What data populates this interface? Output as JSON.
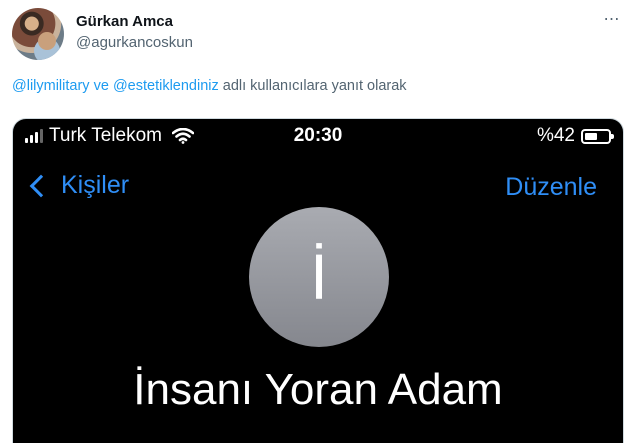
{
  "tweet": {
    "author_name": "Gürkan Amca",
    "author_handle": "@agurkancoskun",
    "more_label": "⋯",
    "reply": {
      "mention_1": "@lilymilitary",
      "joiner": " ve ",
      "mention_2": "@estetiklendiniz",
      "suffix": " adlı kullanıcılara yanıt olarak"
    },
    "accent_color": "#1d9bf0"
  },
  "phone": {
    "status_bar": {
      "carrier": "Turk Telekom",
      "time": "20:30",
      "battery": "%42",
      "signal_bars_on": 3,
      "signal_bars_total": 4,
      "battery_level": 0.42
    },
    "nav": {
      "back_label": "Kişiler",
      "edit_label": "Düzenle",
      "tint_color": "#2f8ef6"
    },
    "contact": {
      "initial": "İ",
      "name": "İnsanı Yoran Adam"
    }
  }
}
